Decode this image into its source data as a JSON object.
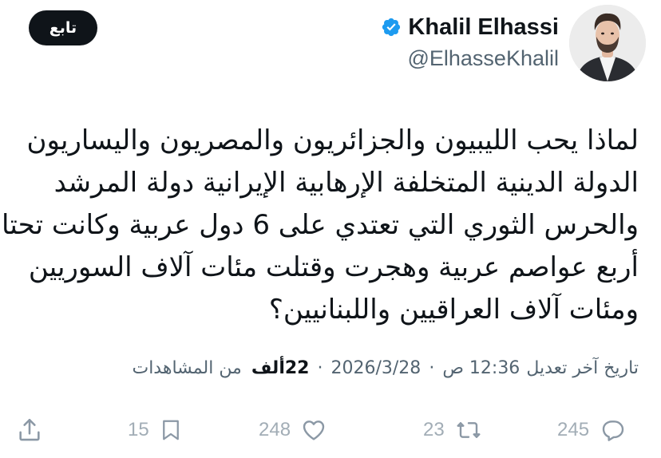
{
  "header": {
    "follow_label": "تابع",
    "display_name": "Khalil Elhassi",
    "handle": "@ElhasseKhalil",
    "verified": true
  },
  "tweet": {
    "lines": [
      "لماذا يحب الليبيون والجزائريون والمصريون واليساريون",
      "الدولة الدينية المتخلفة الإرهابية الإيرانية دولة المرشد",
      "والحرس الثوري التي تعتدي على 6 دول عربية وكانت تحتا",
      "أربع عواصم عربية وهجرت وقتلت مئات آلاف السوريين",
      "ومئات آلاف العراقيين واللبنانيين؟"
    ]
  },
  "meta": {
    "edited_label": "تاريخ آخر تعديل",
    "time": "12:36 ص",
    "date": "2026/3/28",
    "views_count": "22",
    "views_unit": "ألف",
    "views_label": "من المشاهدات"
  },
  "actions": {
    "replies": "245",
    "reposts": "23",
    "likes": "248",
    "bookmarks": "15"
  },
  "colors": {
    "text": "#0f1419",
    "secondary": "#536471",
    "verified": "#1d9bf0",
    "follow_bg": "#0f1419"
  },
  "icons": {
    "verified": "verified-badge-icon",
    "reply": "reply-icon",
    "repost": "repost-icon",
    "like": "heart-icon",
    "bookmark": "bookmark-icon",
    "share": "share-icon"
  }
}
